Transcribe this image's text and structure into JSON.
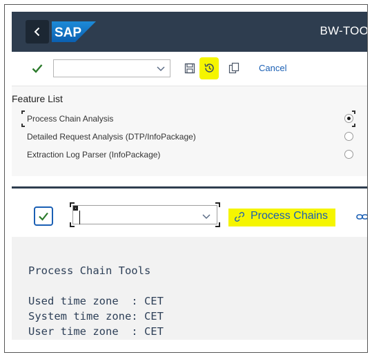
{
  "shell": {
    "back_icon": "chevron-left-icon",
    "logo_text": "SAP",
    "title": "BW-TOO"
  },
  "toolbar": {
    "confirm_icon": "check-icon",
    "selection_value": "",
    "save_icon": "save-icon",
    "history_icon": "history-icon",
    "copy_icon": "copy-icon",
    "cancel_label": "Cancel",
    "highlight_color": "#f5f500"
  },
  "feature_list": {
    "title": "Feature List",
    "items": [
      {
        "label": "Process Chain Analysis",
        "selected": true
      },
      {
        "label": "Detailed Request Analysis (DTP/InfoPackage)",
        "selected": false
      },
      {
        "label": "Extraction Log Parser (InfoPackage)",
        "selected": false
      }
    ]
  },
  "secondary_toolbar": {
    "confirm_icon": "check-icon",
    "dropdown_value": "",
    "link_icon": "link-icon",
    "process_chains_label": "Process Chains",
    "highlight_color": "#f5f500"
  },
  "console": {
    "heading": "Process Chain Tools",
    "lines": [
      "Used time zone  : CET",
      "System time zone: CET",
      "User time zone  : CET"
    ]
  },
  "colors": {
    "shell_bar": "#2e3d4f",
    "accent": "#1a5fb4",
    "check_green": "#2b7a2b",
    "console_text": "#2d3f57"
  }
}
